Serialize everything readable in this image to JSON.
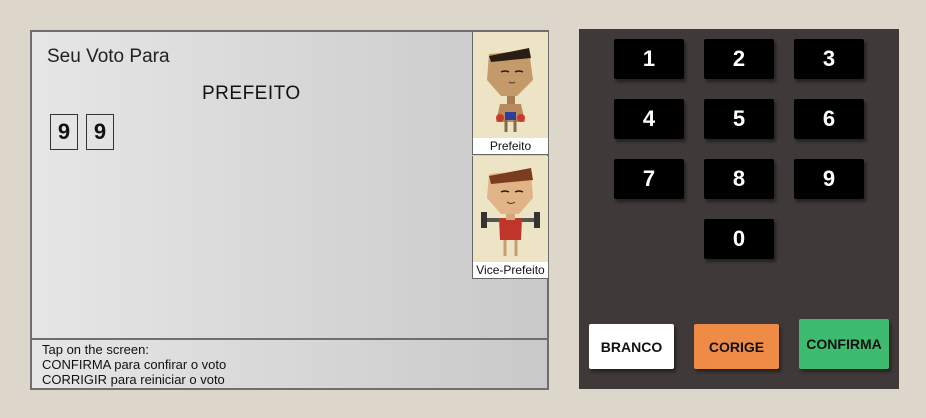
{
  "screen": {
    "vote_title": "Seu Voto Para",
    "office": "PREFEITO",
    "digits": [
      "9",
      "9"
    ],
    "candidates": [
      {
        "caption": "Prefeito"
      },
      {
        "caption": "Vice-Prefeito"
      }
    ],
    "instructions": {
      "line1": "Tap on the screen:",
      "line2": "CONFIRMA para confirar o voto",
      "line3": "CORRIGIR para reiniciar o voto"
    }
  },
  "keypad": {
    "keys": [
      "1",
      "2",
      "3",
      "4",
      "5",
      "6",
      "7",
      "8",
      "9",
      "0"
    ],
    "branco": "BRANCO",
    "corrige": "CORIGE",
    "confirma": "CONFIRMA"
  },
  "colors": {
    "branco_bg": "#ffffff",
    "corrige_bg": "#ee8c47",
    "confirma_bg": "#3dbb6e",
    "keypad_bg": "#3f3a39"
  }
}
